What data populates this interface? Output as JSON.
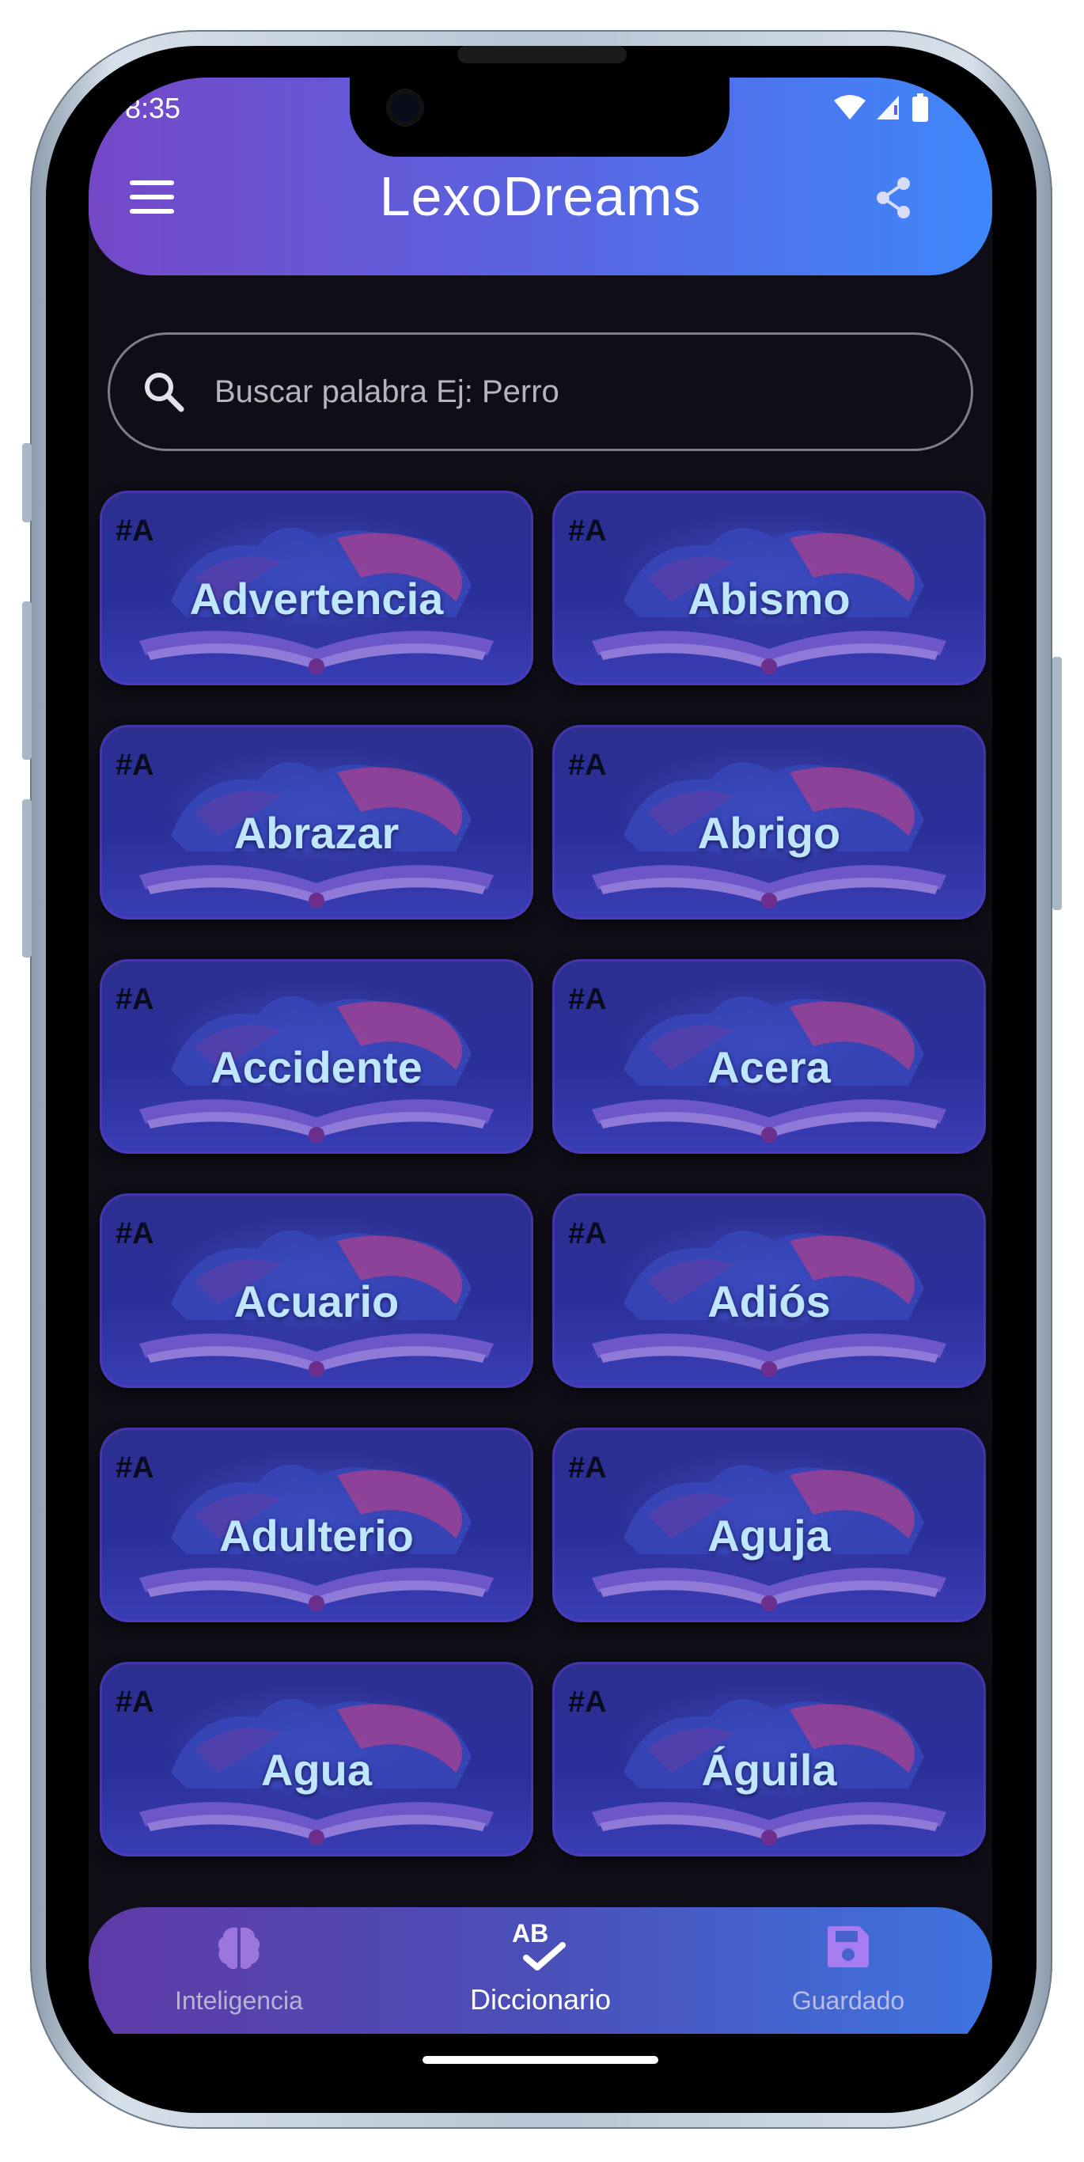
{
  "status_bar": {
    "time": "8:35"
  },
  "header": {
    "title": "LexoDreams"
  },
  "search": {
    "placeholder": "Buscar palabra Ej: Perro"
  },
  "words": [
    {
      "tag": "#A",
      "word": "Advertencia"
    },
    {
      "tag": "#A",
      "word": "Abismo"
    },
    {
      "tag": "#A",
      "word": "Abrazar"
    },
    {
      "tag": "#A",
      "word": "Abrigo"
    },
    {
      "tag": "#A",
      "word": "Accidente"
    },
    {
      "tag": "#A",
      "word": "Acera"
    },
    {
      "tag": "#A",
      "word": "Acuario"
    },
    {
      "tag": "#A",
      "word": "Adiós"
    },
    {
      "tag": "#A",
      "word": "Adulterio"
    },
    {
      "tag": "#A",
      "word": "Aguja"
    },
    {
      "tag": "#A",
      "word": "Agua"
    },
    {
      "tag": "#A",
      "word": "Águila"
    }
  ],
  "bottom_nav": {
    "items": [
      {
        "label": "Inteligencia",
        "icon": "brain-icon",
        "active": false
      },
      {
        "label": "Diccionario",
        "icon": "spellcheck-icon",
        "active": true
      },
      {
        "label": "Guardado",
        "icon": "save-icon",
        "active": false
      }
    ]
  },
  "colors": {
    "header_gradient_start": "#7548c8",
    "header_gradient_end": "#3f87fb",
    "card_background": "#2b2f8f",
    "card_word": "#bfe6ff",
    "screen_background": "#0f0e16"
  }
}
